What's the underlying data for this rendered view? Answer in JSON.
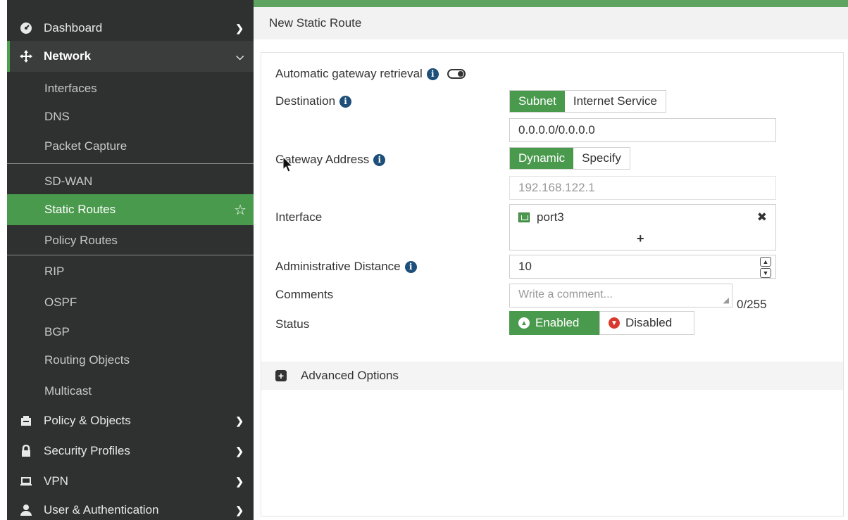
{
  "sidebar": {
    "items": [
      {
        "label": "Dashboard",
        "icon": "dashboard-icon"
      },
      {
        "label": "Network",
        "icon": "network-move-icon",
        "expanded": true
      },
      {
        "label": "Policy & Objects",
        "icon": "policy-icon"
      },
      {
        "label": "Security Profiles",
        "icon": "lock-icon"
      },
      {
        "label": "VPN",
        "icon": "laptop-icon"
      },
      {
        "label": "User & Authentication",
        "icon": "user-icon"
      }
    ],
    "network_sub": [
      "Interfaces",
      "DNS",
      "Packet Capture",
      "SD-WAN",
      "Static Routes",
      "Policy Routes",
      "RIP",
      "OSPF",
      "BGP",
      "Routing Objects",
      "Multicast"
    ],
    "selected": "Static Routes"
  },
  "header": {
    "title": "New Static Route"
  },
  "form": {
    "auto_gateway_label": "Automatic gateway retrieval",
    "destination_label": "Destination",
    "destination_options": [
      "Subnet",
      "Internet Service"
    ],
    "destination_value": "0.0.0.0/0.0.0.0",
    "gateway_label": "Gateway Address",
    "gateway_options": [
      "Dynamic",
      "Specify"
    ],
    "gateway_value": "192.168.122.1",
    "interface_label": "Interface",
    "interface_value": "port3",
    "admin_distance_label": "Administrative Distance",
    "admin_distance_value": "10",
    "comments_label": "Comments",
    "comments_placeholder": "Write a comment...",
    "comments_counter": "0/255",
    "status_label": "Status",
    "status_enabled": "Enabled",
    "status_disabled": "Disabled",
    "advanced_label": "Advanced Options"
  },
  "colors": {
    "accent": "#4a9a4d",
    "sidebar_bg": "#2f3130",
    "info": "#1d4f7a"
  }
}
